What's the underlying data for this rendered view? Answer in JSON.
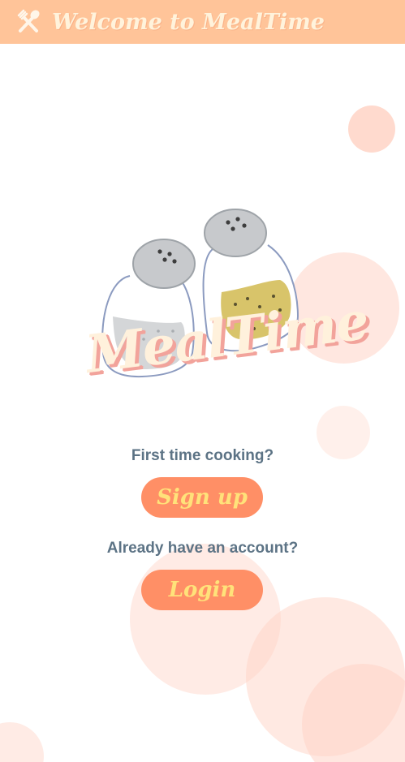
{
  "header": {
    "title": "Welcome to MealTime",
    "icon": "fork-spoon-icon",
    "background": "#ffc499"
  },
  "logo": {
    "text": "MealTime",
    "image": "salt-and-pepper-shakers-illustration"
  },
  "signup": {
    "prompt": "First time cooking?",
    "button_label": "Sign up"
  },
  "login": {
    "prompt": "Already have an account?",
    "button_label": "Login"
  },
  "colors": {
    "accent_button": "#ff8f66",
    "button_text": "#ffe27a",
    "prompt_text": "#5c7385",
    "bubble": "#ffd3c6"
  }
}
